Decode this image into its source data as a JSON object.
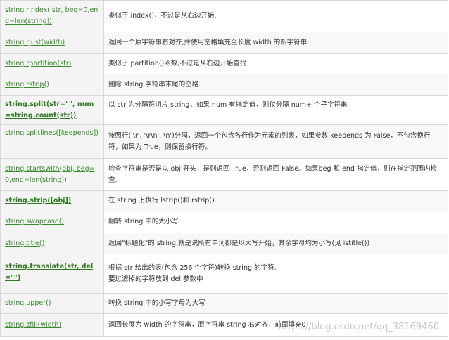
{
  "rows": [
    {
      "method": "string.rindex( str, beg=0,end=len(string))",
      "description": "类似于 index()，不过是从右边开始.",
      "bold": false
    },
    {
      "method": "string.rjust(width)",
      "description": "返回一个原字符串右对齐,并使用空格填充至长度 width 的新字符串",
      "bold": false
    },
    {
      "method": "string.rpartition(str)",
      "description": "类似于 partition()函数,不过是从右边开始查找",
      "bold": false
    },
    {
      "method": "string.rstrip()",
      "description": "删除 string 字符串末尾的空格.",
      "bold": false
    },
    {
      "method": "string.split(str=\"\", num=string.count(str))",
      "description": "以 str 为分隔符切片 string，如果 num 有指定值，则仅分隔 num+ 个子字符串",
      "bold": true
    },
    {
      "method": "string.splitlines([keepends])",
      "description": "按照行('\\r', '\\r\\n', \\n')分隔，返回一个包含各行作为元素的列表，如果参数 keepends 为 False，不包含换行符，如果为 True，则保留换行符。",
      "bold": false
    },
    {
      "method": "string.startswith(obj, beg=0,end=len(string))",
      "description": "检查字符串是否是以 obj 开头，是则返回 True，否则返回 False。如果beg 和 end 指定值，则在指定范围内检查.",
      "bold": false
    },
    {
      "method": "string.strip([obj])",
      "description": "在 string 上执行 lstrip()和 rstrip()",
      "bold": true
    },
    {
      "method": "string.swapcase()",
      "description": "翻转 string 中的大小写",
      "bold": false
    },
    {
      "method": "string.title()",
      "description": "返回\"标题化\"的 string,就是说所有单词都是以大写开始，其余字母均为小写(见 istitle())",
      "bold": false
    },
    {
      "method": "string.translate(str, del=\"\")",
      "description": "根据 str 给出的表(包含 256 个字符)转换 string 的字符,\n要过滤掉的字符放到 del 参数中",
      "bold": true
    },
    {
      "method": "string.upper()",
      "description": "转换 string 中的小写字母为大写",
      "bold": false
    },
    {
      "method": "string.zfill(width)",
      "description": "返回长度为 width 的字符串，原字符串 string 右对齐，前面填充0",
      "bold": false
    }
  ],
  "watermark": "https://blog.csdn.net/qq_38169460"
}
